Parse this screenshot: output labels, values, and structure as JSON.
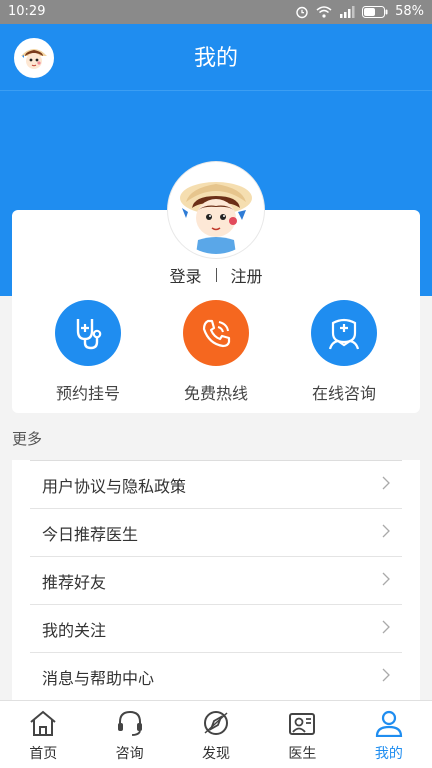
{
  "status_bar": {
    "time": "10:29",
    "battery": "58%"
  },
  "header": {
    "title": "我的"
  },
  "profile": {
    "login": "登录",
    "register": "注册"
  },
  "services": [
    {
      "label": "预约挂号",
      "icon": "stethoscope-icon",
      "color": "#1f8df0"
    },
    {
      "label": "免费热线",
      "icon": "phone-icon",
      "color": "#f5671f"
    },
    {
      "label": "在线咨询",
      "icon": "doctor-icon",
      "color": "#1f8df0"
    }
  ],
  "more": {
    "title": "更多"
  },
  "menu": [
    {
      "label": "用户协议与隐私政策"
    },
    {
      "label": "今日推荐医生"
    },
    {
      "label": "推荐好友"
    },
    {
      "label": "我的关注"
    },
    {
      "label": "消息与帮助中心"
    }
  ],
  "tabs": [
    {
      "label": "首页",
      "icon": "home-icon"
    },
    {
      "label": "咨询",
      "icon": "headset-icon"
    },
    {
      "label": "发现",
      "icon": "compass-icon"
    },
    {
      "label": "医生",
      "icon": "doctor-card-icon"
    },
    {
      "label": "我的",
      "icon": "user-icon",
      "active": true
    }
  ],
  "colors": {
    "primary": "#1f8df0",
    "hotline": "#f5671f"
  }
}
